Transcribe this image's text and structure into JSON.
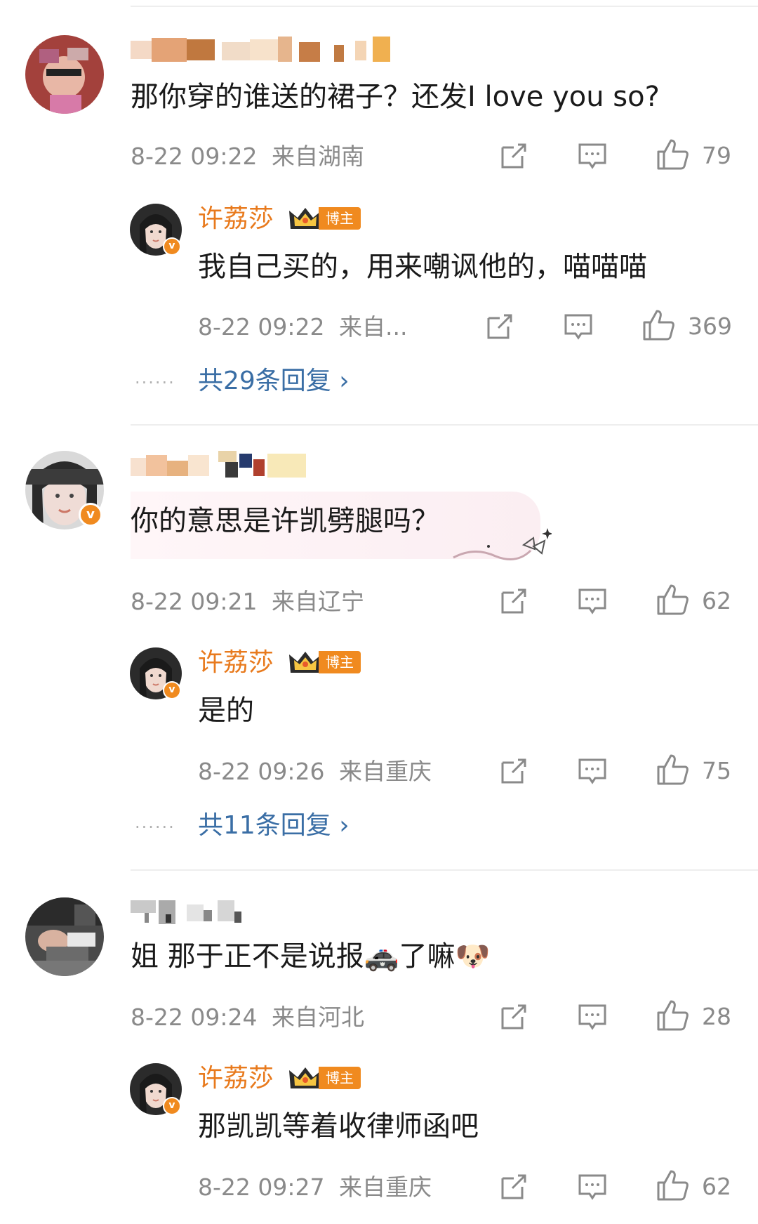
{
  "comments": [
    {
      "text": "那你穿的谁送的裙子？还发I love you so?",
      "time": "8-22 09:22",
      "location": "来自湖南",
      "likes": "79",
      "reply": {
        "name": "许荔莎",
        "badge": "博主",
        "text": "我自己买的，用来嘲讽他的，喵喵喵",
        "time": "8-22 09:22",
        "location": "来自...",
        "likes": "369"
      },
      "more_replies": "共29条回复 ›"
    },
    {
      "text": "你的意思是许凯劈腿吗？",
      "time": "8-22 09:21",
      "location": "来自辽宁",
      "likes": "62",
      "reply": {
        "name": "许荔莎",
        "badge": "博主",
        "text": "是的",
        "time": "8-22 09:26",
        "location": "来自重庆",
        "likes": "75"
      },
      "more_replies": "共11条回复 ›"
    },
    {
      "text": "姐 那于正不是说报🚓了嘛🐶",
      "time": "8-22 09:24",
      "location": "来自河北",
      "likes": "28",
      "reply": {
        "name": "许荔莎",
        "badge": "博主",
        "text": "那凯凯等着收律师函吧",
        "time": "8-22 09:27",
        "location": "来自重庆",
        "likes": "62"
      }
    }
  ],
  "ui": {
    "more_dots": "······",
    "verified_mark": "v"
  },
  "icons": {
    "share": "share-icon",
    "comment": "comment-icon",
    "like": "like-icon"
  },
  "colors": {
    "accent_name": "#e87a1d",
    "link": "#3a6ea5",
    "meta": "#8a8a8a"
  }
}
